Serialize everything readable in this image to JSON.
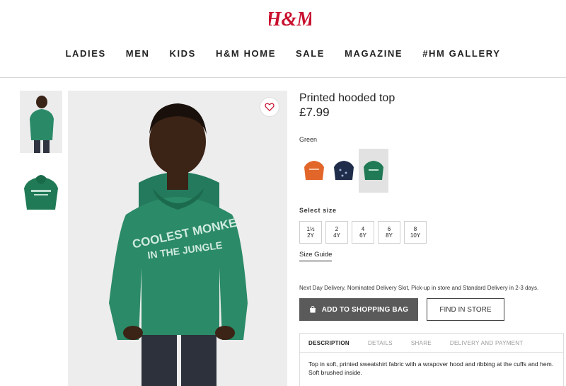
{
  "brand": {
    "logo_text": "H&M",
    "accent_color": "#c8102e"
  },
  "nav": {
    "items": [
      "LADIES",
      "MEN",
      "KIDS",
      "H&M HOME",
      "SALE",
      "MAGAZINE",
      "#HM GALLERY"
    ]
  },
  "gallery": {
    "thumbnails": [
      "child-in-green-hoodie",
      "green-hoodie-flat"
    ],
    "main_image": "child wearing green hoodie",
    "hoodie_print_line1": "COOLEST MONKE",
    "hoodie_print_line2": "IN THE JUNGLE"
  },
  "product": {
    "title": "Printed hooded top",
    "price": "£7.99",
    "color_label": "Green",
    "swatch_colors": [
      "#e2662a",
      "#1f2d4a",
      "#1f7a55"
    ],
    "selected_swatch": 2,
    "size_label": "Select size",
    "sizes": [
      {
        "line1": "1½",
        "line2": "2Y"
      },
      {
        "line1": "2",
        "line2": "4Y"
      },
      {
        "line1": "4",
        "line2": "6Y"
      },
      {
        "line1": "6",
        "line2": "8Y"
      },
      {
        "line1": "8",
        "line2": "10Y"
      }
    ],
    "size_guide": "Size Guide",
    "delivery_text": "Next Day Delivery, Nominated Delivery Slot, Pick-up in store and Standard Delivery in 2-3 days.",
    "add_to_bag": "ADD TO SHOPPING BAG",
    "find_in_store": "FIND IN STORE"
  },
  "tabs": {
    "items": [
      "DESCRIPTION",
      "DETAILS",
      "SHARE",
      "DELIVERY AND PAYMENT"
    ],
    "active": 0,
    "description": "Top in soft, printed sweatshirt fabric with a wrapover hood and ribbing at the cuffs and hem. Soft brushed inside."
  }
}
